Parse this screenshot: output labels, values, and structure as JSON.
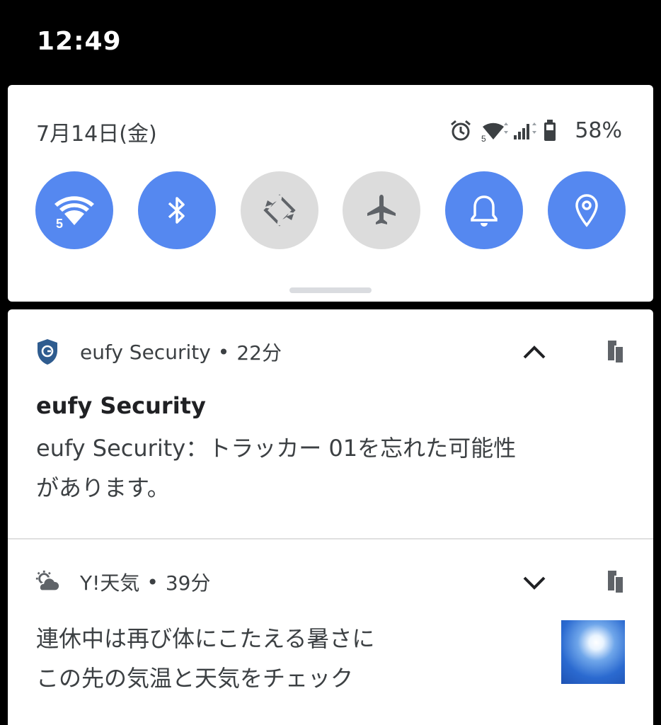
{
  "status_bar": {
    "time": "12:49"
  },
  "quick_settings": {
    "date": "7月14日(金)",
    "battery": "58%",
    "tiles": [
      {
        "name": "wifi",
        "icon": "wifi-icon",
        "state": "on"
      },
      {
        "name": "bluetooth",
        "icon": "bluetooth-icon",
        "state": "on"
      },
      {
        "name": "auto-rotate",
        "icon": "rotate-icon",
        "state": "off"
      },
      {
        "name": "airplane",
        "icon": "airplane-icon",
        "state": "off"
      },
      {
        "name": "sound",
        "icon": "bell-icon",
        "state": "on"
      },
      {
        "name": "location",
        "icon": "location-icon",
        "state": "on"
      }
    ],
    "colors": {
      "tile_on": "#5588f0",
      "tile_off": "#dcdcdc"
    }
  },
  "notifications": [
    {
      "app": "eufy Security",
      "separator": "•",
      "time": "22分",
      "icon": "shield-icon",
      "title": "eufy Security",
      "body_line1": "eufy Security：トラッカー 01を忘れた可能性",
      "body_line2": "があります。",
      "expand_icon": "chevron-up-icon"
    },
    {
      "app": "Y!天気",
      "separator": "•",
      "time": "39分",
      "icon": "weather-icon",
      "body_line1": "連休中は再び体にこたえる暑さに",
      "body_line2": "この先の気温と天気をチェック",
      "expand_icon": "chevron-down-icon"
    }
  ]
}
